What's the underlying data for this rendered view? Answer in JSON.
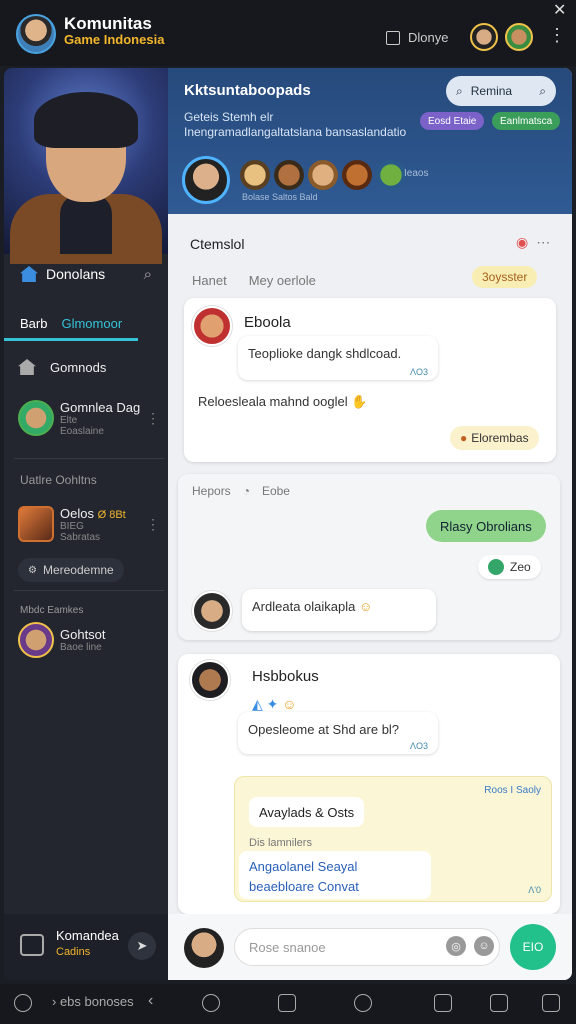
{
  "topbar": {
    "title": "Komunitas",
    "subtitle": "Game Indonesia",
    "device_label": "Dlonye"
  },
  "sidebar": {
    "section_title": "Donolans",
    "tabs": [
      "Barb",
      "Glmomoor"
    ],
    "items": [
      {
        "label": "Gomnods"
      },
      {
        "label": "Gomnlea Dag",
        "sub1": "Elte",
        "sub2": "Eoaslaine"
      }
    ],
    "section2": "Uatlre Oohltns",
    "item3": {
      "label": "Oelos",
      "badge": "Ø 8Bt",
      "sub1": "BIEG",
      "sub2": "Sabratas"
    },
    "chip": "Mereodemne",
    "section3": "Mbdc Eamkes",
    "item4": {
      "label": "Gohtsot",
      "sub": "Baoe line"
    },
    "bottom": {
      "title": "Komandea",
      "sub": "Cadins"
    }
  },
  "channel": {
    "title": "Kktsuntaboopads",
    "search_label": "Remina",
    "description": "Geteis Stemh elr Inengramadlangaltatslana bansaslandatio",
    "badge_a": "Eosd Etaie",
    "badge_b": "Eanlmatsca",
    "member_names": "Bolase Saltos Bald",
    "member_count": "Ieaos"
  },
  "card1": {
    "title": "Ctemslol",
    "tabs": [
      "Hanet",
      "Mey oerlole"
    ],
    "pill": "3oysster",
    "post_name": "Eboola",
    "post_text": "Teoplioke dangk shdlcoad.",
    "post_meta": "ɅO3",
    "system_line": "Reloesleala mahnd ooglel",
    "reaction": "Elorembas"
  },
  "card2": {
    "head_a": "Hepors",
    "head_b": "Eobe",
    "sent_text": "Rlasy Obrolians",
    "sent_status": "Zeo",
    "incoming_text": "Ardleata olaikapla"
  },
  "post3": {
    "name": "Hsbbokus",
    "bubble_text": "Opesleome at Shd are bl?",
    "meta": "ɅO3"
  },
  "yellow_card": {
    "label": "Avaylads & Osts",
    "corner": "Roos I Saoly",
    "sub": "Dis lamnilers",
    "links": [
      "Angaolanel Seayal",
      "beaebloare Convat"
    ],
    "time": "Ʌ'0"
  },
  "composer": {
    "placeholder": "Rose snanoe",
    "send_label": "EIO"
  },
  "bottombar": {
    "text": "› ebs bonoses"
  }
}
